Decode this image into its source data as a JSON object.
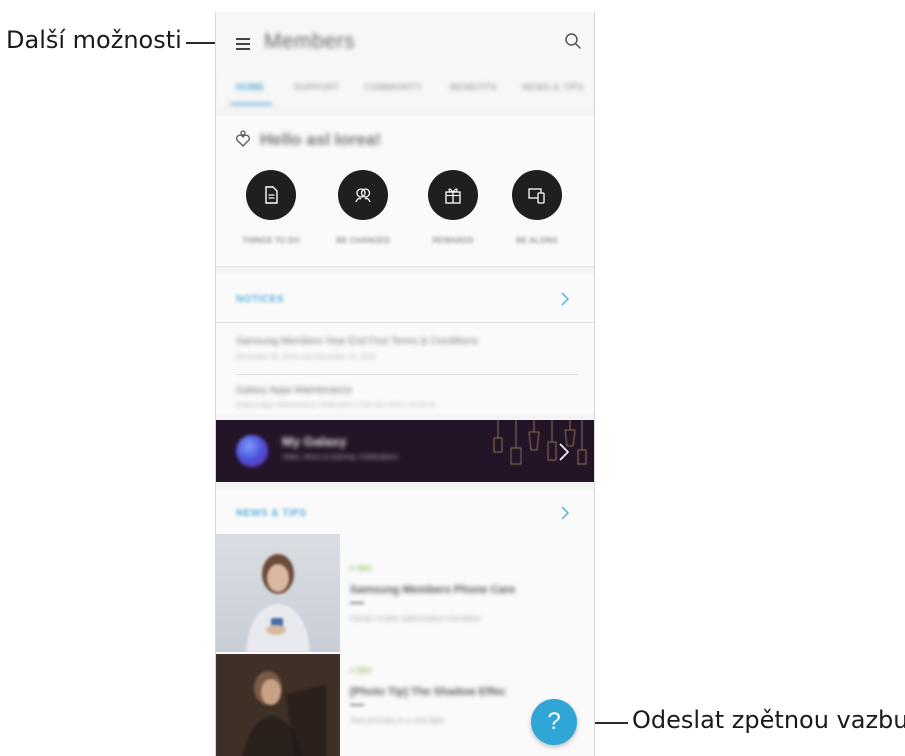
{
  "callouts": {
    "more_options": "Další možnosti",
    "send_feedback": "Odeslat zpětnou vazbu."
  },
  "app": {
    "title": "Members",
    "tabs": [
      {
        "label": "HOME",
        "active": true
      },
      {
        "label": "SUPPORT",
        "active": false
      },
      {
        "label": "COMMUNITY",
        "active": false
      },
      {
        "label": "BENEFITS",
        "active": false
      },
      {
        "label": "NEWS & TIPS",
        "active": false
      }
    ],
    "greeting": "Hello asl Iorea!",
    "quick_actions": [
      {
        "label": "THINGS TO DO",
        "icon": "document-icon"
      },
      {
        "label": "BE CHANGED",
        "icon": "people-icon"
      },
      {
        "label": "REWARDS",
        "icon": "gift-icon"
      },
      {
        "label": "BE ALONG",
        "icon": "devices-icon"
      }
    ],
    "notices": {
      "title": "NOTICES",
      "items": [
        {
          "title": "Samsung Members Year End Fest Terms & Conditions",
          "sub": "December 26, 2018 until December 31, 2018"
        },
        {
          "title": "Galaxy Apps Maintenance",
          "sub": "Galaxy Apps Maintenance Notification (7:00 Jan 2019 / 02:05 Jn"
        }
      ]
    },
    "banner": {
      "title": "My Galaxy",
      "subtitle": "Video, Music & Gaming, Celebrations"
    },
    "news": {
      "title": "NEWS & TIPS",
      "items": [
        {
          "tag": "// TIPS",
          "title": "Samsung Members Phone Care",
          "desc": "Handy mobile optimization checklists"
        },
        {
          "tag": "// TIPS",
          "title": "[Photo Tip] The Shadow Effec",
          "desc": "See portraits in a new light"
        }
      ]
    },
    "feedback_label": "?"
  },
  "colors": {
    "accent": "#4aa3cf",
    "feedback_button": "#2fa6d6",
    "banner_bg": "#241428"
  }
}
